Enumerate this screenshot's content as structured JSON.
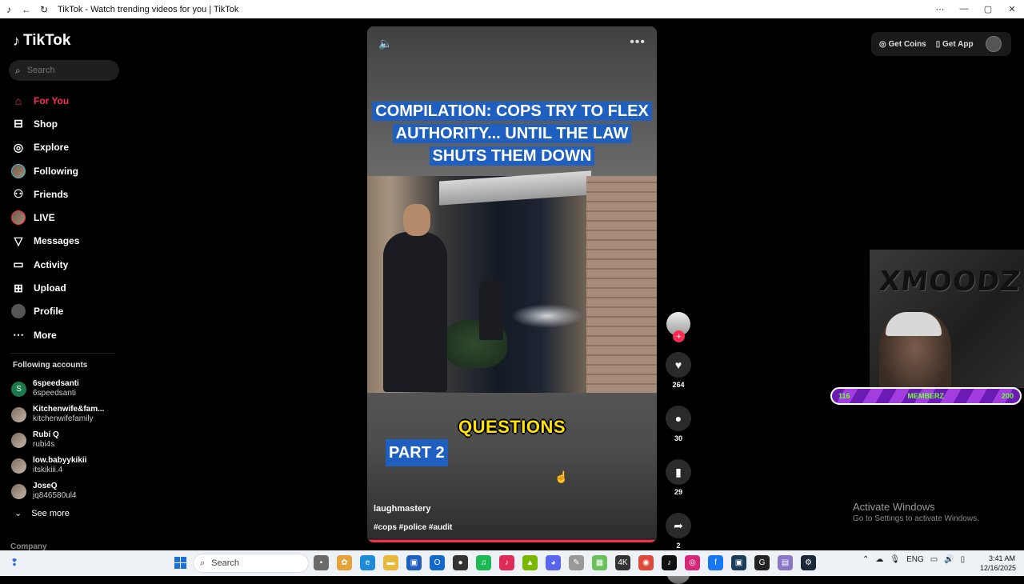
{
  "window": {
    "title": "TikTok - Watch trending videos for you | TikTok"
  },
  "sidebar": {
    "logo": "TikTok",
    "search_placeholder": "Search",
    "nav": [
      {
        "label": "For You",
        "icon": "home-icon",
        "active": true
      },
      {
        "label": "Shop",
        "icon": "shop-bag-icon"
      },
      {
        "label": "Explore",
        "icon": "compass-icon"
      },
      {
        "label": "Following",
        "icon": "avatar"
      },
      {
        "label": "Friends",
        "icon": "friends-icon"
      },
      {
        "label": "LIVE",
        "icon": "avatar"
      },
      {
        "label": "Messages",
        "icon": "send-icon"
      },
      {
        "label": "Activity",
        "icon": "message-box-icon"
      },
      {
        "label": "Upload",
        "icon": "plus-box-icon"
      },
      {
        "label": "Profile",
        "icon": "avatar"
      },
      {
        "label": "More",
        "icon": "more-dots-icon"
      }
    ],
    "following_header": "Following accounts",
    "accounts": [
      {
        "name": "6speedsanti",
        "handle": "6speedsanti"
      },
      {
        "name": "Kitchenwife&fam...",
        "handle": "kitchenwifefamily"
      },
      {
        "name": "Rubí Q",
        "handle": "rubi4s"
      },
      {
        "name": "low.babyykikii",
        "handle": "itskikiii.4"
      },
      {
        "name": "JoseQ",
        "handle": "jq846580ul4"
      }
    ],
    "see_more": "See more",
    "company": "Company"
  },
  "video": {
    "headline": "COMPILATION: COPS TRY TO FLEX AUTHORITY... UNTIL THE LAW SHUTS THEM DOWN",
    "caption_questions": "QUESTIONS",
    "caption_part": "PART 2",
    "author": "laughmastery",
    "tags": "#cops #police #audit"
  },
  "actions": {
    "likes": "264",
    "comments": "30",
    "saves": "29",
    "shares": "2"
  },
  "topbar": {
    "coins": "Get Coins",
    "app": "Get App"
  },
  "overlay": {
    "memberz_left": "116",
    "memberz_label": "MEMBERZ",
    "memberz_right": "200",
    "activate_title": "Activate Windows",
    "activate_sub": "Go to Settings to activate Windows."
  },
  "taskbar": {
    "search": "Search",
    "lang": "ENG",
    "time": "3:41 AM",
    "date": "12/16/2025"
  }
}
